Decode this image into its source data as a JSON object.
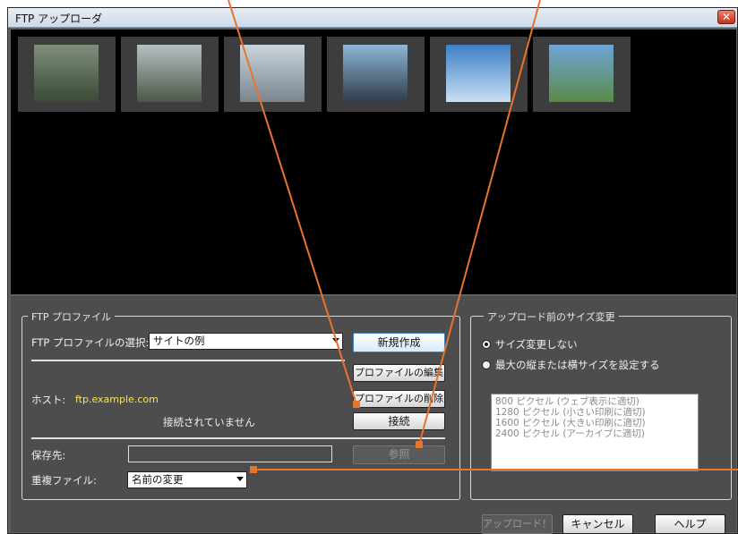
{
  "window": {
    "title": "FTP アップローダ",
    "close_label": "✕"
  },
  "preview": {
    "thumbnails": [
      {
        "name": "lake-reflection",
        "c1": "#7f8f7c",
        "c2": "#3b4a35"
      },
      {
        "name": "misty-lake",
        "c1": "#b8c0c2",
        "c2": "#4a5845"
      },
      {
        "name": "sailing-ship",
        "c1": "#c9d4dc",
        "c2": "#7a8590"
      },
      {
        "name": "harbor-statue",
        "c1": "#8eb6d6",
        "c2": "#2f3d4a"
      },
      {
        "name": "sun-snow",
        "c1": "#3d7fc7",
        "c2": "#c8dff2"
      },
      {
        "name": "mountain-valley",
        "c1": "#6ea5d8",
        "c2": "#5b8a48"
      }
    ]
  },
  "profile": {
    "legend": "FTP プロファイル",
    "select_label": "FTP プロファイルの選択:",
    "select_value": "サイトの例",
    "new_button": "新規作成",
    "edit_button": "プロファイルの編集",
    "delete_button": "プロファイルの削除",
    "host_label": "ホスト:",
    "host_value": "ftp.example.com",
    "status": "接続されていません",
    "connect_button": "接続",
    "save_label": "保存先:",
    "save_value": "",
    "browse_button": "参照",
    "dup_label": "重複ファイル:",
    "dup_value": "名前の変更"
  },
  "resize": {
    "legend": "アップロード前のサイズ変更",
    "option_none": "サイズ変更しない",
    "option_max": "最大の縦または横サイズを設定する",
    "sizes": [
      "800 ピクセル (ウェブ表示に適切)",
      "1280 ピクセル (小さい印刷に適切)",
      "1600 ピクセル (大きい印刷に適切)",
      "2400 ピクセル (アーカイブに適切)"
    ]
  },
  "footer": {
    "upload_button": "アップロード！",
    "cancel_button": "キャンセル",
    "help_button": "ヘルプ"
  },
  "colors": {
    "callout": "#e8742c",
    "host_text": "#ffe54a"
  }
}
